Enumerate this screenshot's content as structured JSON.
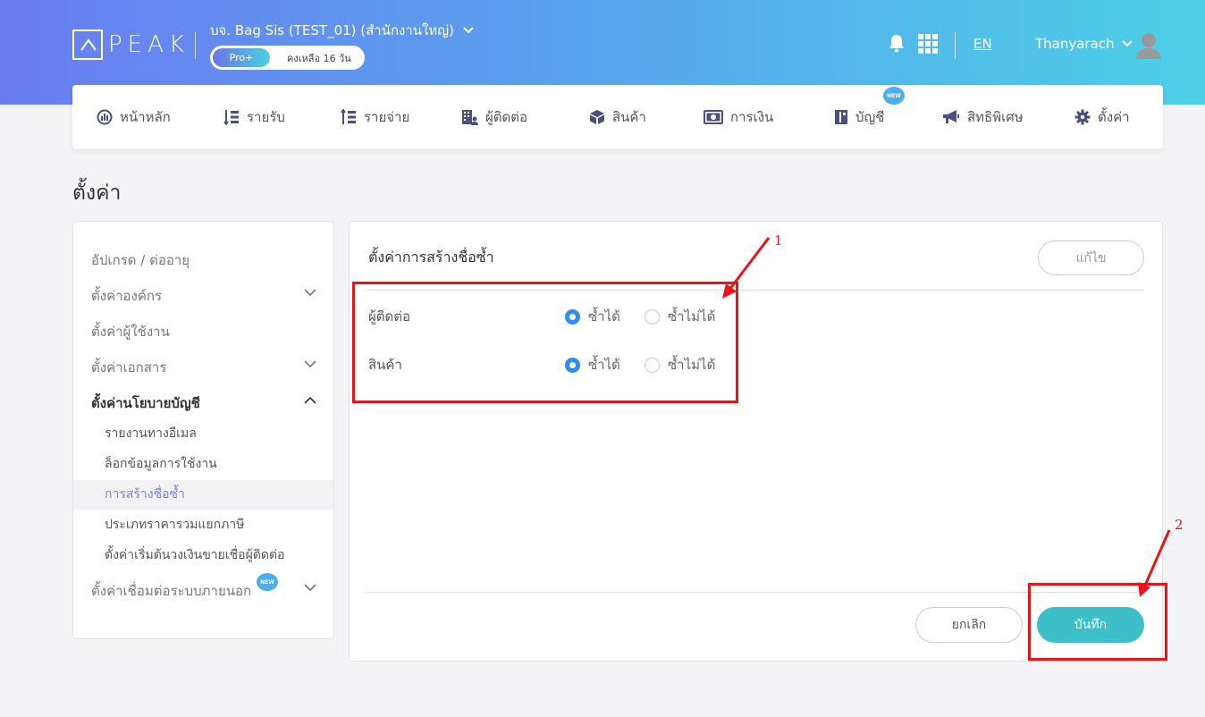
{
  "header": {
    "logo_text": "PEAK",
    "company": "บจ. Bag Sis (TEST_01) (สำนักงานใหญ่)",
    "plan": "Pro+",
    "plan_remaining": "คงเหลือ 16 วัน",
    "lang": "EN",
    "user": "Thanyarach",
    "gradient_start": "#6a7df0",
    "gradient_end": "#4cd0e6"
  },
  "nav": {
    "items": [
      {
        "label": "หน้าหลัก",
        "icon": "dashboard-icon"
      },
      {
        "label": "รายรับ",
        "icon": "income-icon"
      },
      {
        "label": "รายจ่าย",
        "icon": "expense-icon"
      },
      {
        "label": "ผู้ติดต่อ",
        "icon": "contacts-icon"
      },
      {
        "label": "สินค้า",
        "icon": "box-icon"
      },
      {
        "label": "การเงิน",
        "icon": "money-icon"
      },
      {
        "label": "บัญชี",
        "icon": "ledger-icon",
        "badge": "NEW"
      },
      {
        "label": "สิทธิพิเศษ",
        "icon": "megaphone-icon"
      },
      {
        "label": "ตั้งค่า",
        "icon": "gear-icon"
      }
    ]
  },
  "page": {
    "title": "ตั้งค่า"
  },
  "sidebar": {
    "items": [
      {
        "label": "อัปเกรด / ต่ออายุ"
      },
      {
        "label": "ตั้งค่าองค์กร"
      },
      {
        "label": "ตั้งค่าผู้ใช้งาน"
      },
      {
        "label": "ตั้งค่าเอกสาร"
      },
      {
        "label": "ตั้งค่านโยบายบัญชี"
      },
      {
        "label": "ตั้งค่าเชื่อมต่อระบบภายนอก",
        "badge": "NEW"
      }
    ],
    "sub_items": [
      {
        "label": "รายงานทางอีเมล"
      },
      {
        "label": "ล็อกข้อมูลการใช้งาน"
      },
      {
        "label": "การสร้างชื่อซ้ำ"
      },
      {
        "label": "ประเภทราคารวมแยกภาษี"
      },
      {
        "label": "ตั้งค่าเริ่มต้นวงเงินขายเชื่อผู้ติดต่อ"
      }
    ]
  },
  "panel": {
    "title": "ตั้งค่าการสร้างชื่อซ้ำ",
    "edit_label": "แก้ไข",
    "rows": [
      {
        "label": "ผู้ติดต่อ",
        "option_yes": "ซ้ำได้",
        "option_no": "ซ้ำไม่ได้",
        "selected": "ซ้ำได้"
      },
      {
        "label": "สินค้า",
        "option_yes": "ซ้ำได้",
        "option_no": "ซ้ำไม่ได้",
        "selected": "ซ้ำได้"
      }
    ],
    "cancel_label": "ยกเลิก",
    "save_label": "บันทึก"
  },
  "annotations": {
    "marker_1": "1",
    "marker_2": "2",
    "color": "#e8141a"
  }
}
